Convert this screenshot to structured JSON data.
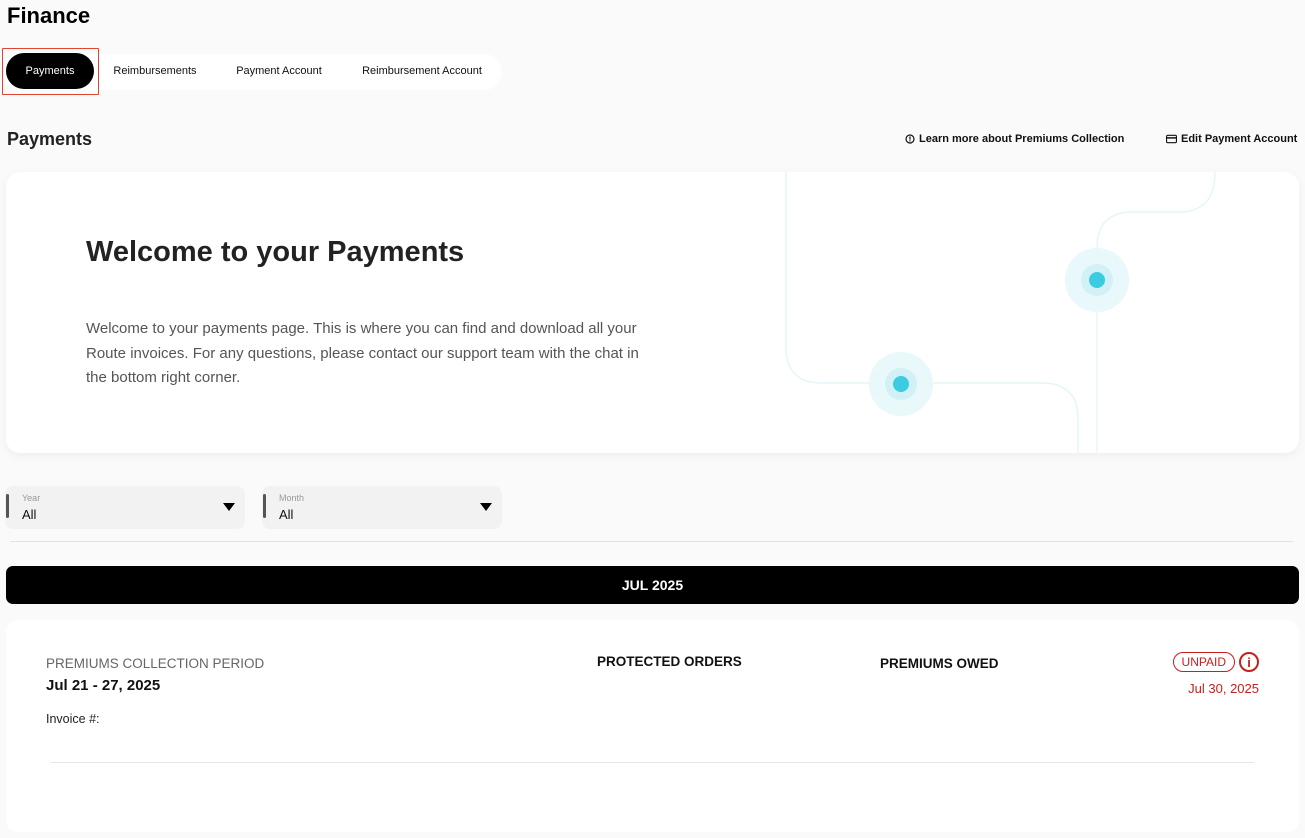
{
  "page": {
    "title": "Finance"
  },
  "tabs": [
    {
      "label": "Payments",
      "active": true
    },
    {
      "label": "Reimbursements",
      "active": false
    },
    {
      "label": "Payment Account",
      "active": false
    },
    {
      "label": "Reimbursement Account",
      "active": false
    }
  ],
  "section": {
    "title": "Payments",
    "learn_more": "Learn more about Premiums Collection",
    "edit_account": "Edit Payment Account"
  },
  "welcome": {
    "heading": "Welcome to your Payments",
    "body": "Welcome to your payments page. This is where you can find and download all your Route invoices. For any questions, please contact our support team with the chat in the bottom right corner."
  },
  "filters": {
    "year": {
      "label": "Year",
      "value": "All"
    },
    "month": {
      "label": "Month",
      "value": "All"
    }
  },
  "month_group": {
    "label": "JUL 2025"
  },
  "period": {
    "label": "PREMIUMS COLLECTION PERIOD",
    "dates": "Jul 21 - 27, 2025",
    "invoice_label": "Invoice #:",
    "protected_orders_header": "PROTECTED ORDERS",
    "premiums_owed_header": "PREMIUMS OWED",
    "status": "UNPAID",
    "due_date": "Jul 30, 2025"
  },
  "colors": {
    "accent": "#000000",
    "status_unpaid": "#c81e1e",
    "decor_dot": "#3ccbe0",
    "tab_highlight": "#e0452d"
  },
  "icons": {
    "learn_more": "info-circle-icon",
    "edit_account": "credit-card-icon",
    "status_info": "info-icon",
    "dropdown": "caret-down-icon"
  }
}
